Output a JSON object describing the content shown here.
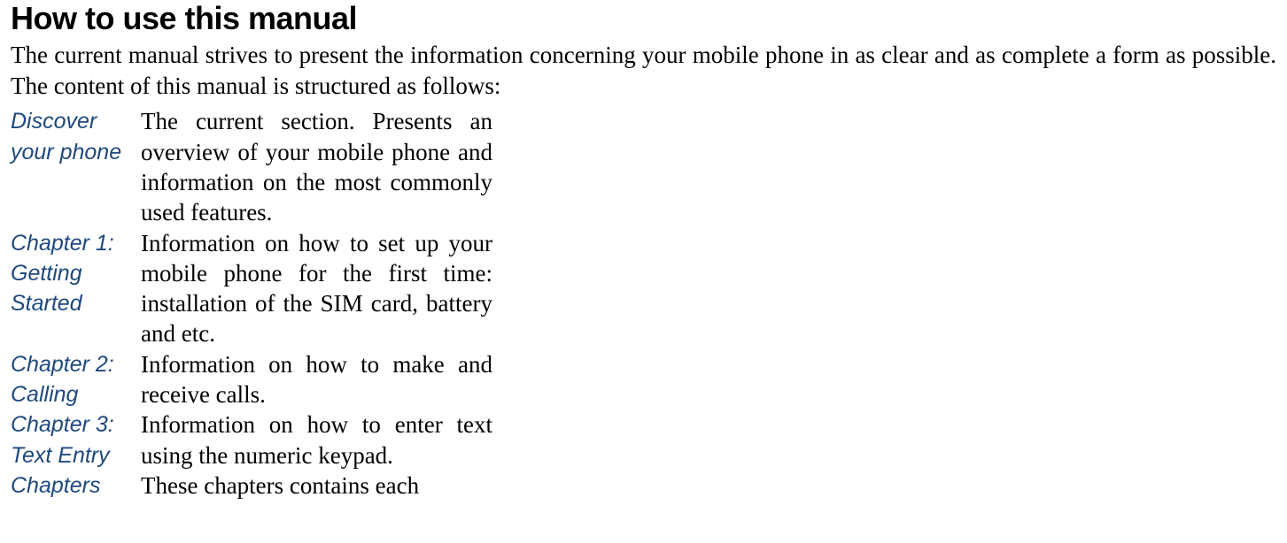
{
  "title": "How to use this manual",
  "intro": "The current manual strives to present the information concerning your mobile phone in as clear and as complete a form as possible. The content of this manual is structured as follows:",
  "sections": [
    {
      "label": "Discover your phone",
      "desc": "The current section. Presents an overview of your mobile phone and information on the most commonly used features."
    },
    {
      "label": "Chapter 1: Getting Started",
      "desc": "Information on how to set up your mobile phone for the first time: installation of the SIM card, battery and etc."
    },
    {
      "label": "Chapter 2: Calling",
      "desc": "Information on how to make and receive calls."
    },
    {
      "label": "Chapter 3: Text Entry",
      "desc": "Information on how to enter text using the numeric keypad."
    },
    {
      "label": "Chapters",
      "desc": "These chapters contains each"
    }
  ]
}
